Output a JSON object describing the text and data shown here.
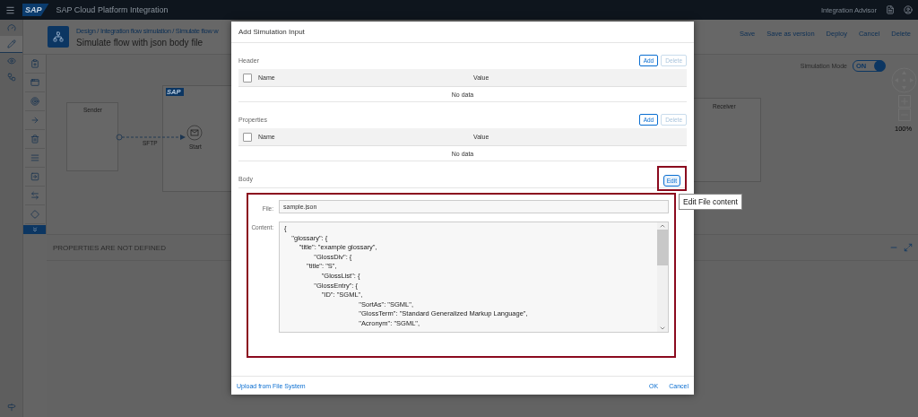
{
  "shell": {
    "logo": "SAP",
    "title": "SAP Cloud Platform Integration",
    "advisor": "Integration Advisor"
  },
  "nav_items": [
    {
      "selected": false
    },
    {
      "selected": true
    },
    {
      "selected": false
    },
    {
      "selected": false
    }
  ],
  "page": {
    "breadcrumb": "Design / Integration flow simulation / Simulate flow w",
    "title": "Simulate flow with json body file",
    "actions": [
      "Save",
      "Save as version",
      "Deploy",
      "Cancel",
      "Delete"
    ]
  },
  "canvas": {
    "sender": "Sender",
    "adapter": "SFTP",
    "start": "Start",
    "pool_logo": "SAP",
    "receiver": "Receiver",
    "simulation_mode": {
      "label": "Simulation Mode",
      "state_text": "ON",
      "on": true
    },
    "zoom": "100%"
  },
  "properties_panel": {
    "message": "PROPERTIES ARE NOT DEFINED"
  },
  "dialog": {
    "title": "Add Simulation Input",
    "sections": [
      {
        "title": "Header",
        "add": "Add",
        "delete": "Delete",
        "delete_disabled": true,
        "all_checked": false,
        "columns": [
          "Name",
          "Value"
        ],
        "empty_text": "No data"
      },
      {
        "title": "Properties",
        "add": "Add",
        "delete": "Delete",
        "delete_disabled": true,
        "all_checked": false,
        "columns": [
          "Name",
          "Value"
        ],
        "empty_text": "No data"
      }
    ],
    "body": {
      "title": "Body",
      "edit": "Edit",
      "edit_highlighted": true,
      "content_highlighted": true,
      "file_label": "File:",
      "file": "sample.json",
      "content_label": "Content:",
      "content_lines": [
        "{",
        "    \"glossary\": {",
        "        \"title\": \"example glossary\",",
        "                \"GlossDiv\": {",
        "            \"title\": \"S\",",
        "                    \"GlossList\": {",
        "                \"GlossEntry\": {",
        "                    \"ID\": \"SGML\",",
        "                                        \"SortAs\": \"SGML\",",
        "                                        \"GlossTerm\": \"Standard Generalized Markup Language\",",
        "                                        \"Acronym\": \"SGML\","
      ]
    },
    "tooltip": "Edit File content",
    "footer": {
      "upload": "Upload from File System",
      "ok": "OK",
      "cancel": "Cancel"
    }
  }
}
